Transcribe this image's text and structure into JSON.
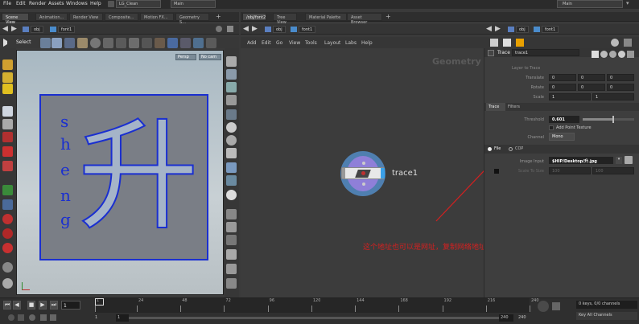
{
  "menubar": {
    "items": [
      "File",
      "Edit",
      "Render",
      "Assets",
      "Windows",
      "Help"
    ],
    "desktop": "LG_Clean",
    "context": "Main",
    "right_context": "Main"
  },
  "left_tabs": [
    "Scene View",
    "Animation...",
    "Render View",
    "Composite...",
    "Motion FX...",
    "Geometry S..."
  ],
  "right_tabs": [
    "/obj/font2",
    "Tree View",
    "Material Palette",
    "Asset Browser"
  ],
  "left_path": {
    "obj": "obj",
    "node": "font1"
  },
  "right_path": {
    "obj": "obj",
    "node": "font1"
  },
  "viewport": {
    "select_label": "Select",
    "persp": "Persp",
    "cam": "No cam",
    "glyph": "升",
    "latin_letters": [
      "s",
      "h",
      "e",
      "n",
      "g"
    ]
  },
  "network_menu": [
    "Add",
    "Edit",
    "Go",
    "View",
    "Tools",
    "Layout",
    "Labs",
    "Help"
  ],
  "network": {
    "context_label": "Geometry",
    "node_label": "trace1"
  },
  "annotation": "这个地址也可以是网址，复制网络地址粘贴即可",
  "params": {
    "node_type": "Trace",
    "node_name": "trace1",
    "layer_label": "Layer to Trace",
    "translate": {
      "label": "Translate",
      "values": [
        "0",
        "0",
        "0"
      ]
    },
    "rotate": {
      "label": "Rotate",
      "values": [
        "0",
        "0",
        "0"
      ]
    },
    "scale": {
      "label": "Scale",
      "values": [
        "1",
        "1"
      ]
    },
    "tabs": [
      "Trace",
      "Filters"
    ],
    "threshold": {
      "label": "Threshold",
      "value": "0.601",
      "fraction": 0.601
    },
    "add_point_texture": "Add Point Texture",
    "channel": {
      "label": "Channel",
      "value": "Mono"
    },
    "source_tabs": [
      "File",
      "COP"
    ],
    "image_input": {
      "label": "Image Input",
      "value": "$HIP/Desktop/升.jpg"
    },
    "scale_to_size": {
      "label": "Scale To Size",
      "values": [
        "100",
        "100"
      ]
    }
  },
  "timeline": {
    "current_frame": "1",
    "ticks": [
      "1",
      "24",
      "48",
      "72",
      "96",
      "120",
      "144",
      "168",
      "192",
      "216",
      "240"
    ],
    "start": "1",
    "start2": "1",
    "end": "240",
    "end2": "240",
    "keys": "0 keys, 0/0 channels",
    "key_all": "Key All Channels"
  },
  "colors": {
    "accent": "#e8a000",
    "annotation": "#d42020",
    "node_ring": "#4f7fb0",
    "node_inner": "#8f7fd8",
    "glyph_fill": "#a5b4c8",
    "glyph_stroke": "#1a2fd0"
  }
}
